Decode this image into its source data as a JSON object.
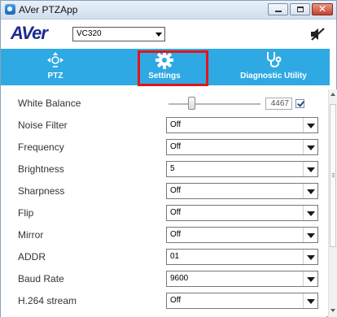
{
  "window": {
    "title": "AVer PTZApp"
  },
  "header": {
    "logo": "AVer",
    "camera_model": "VC320"
  },
  "nav": {
    "items": [
      {
        "label": "PTZ",
        "icon": "ptz-icon"
      },
      {
        "label": "Settings",
        "icon": "gear-icon",
        "selected": true
      },
      {
        "label": "Diagnostic Utility",
        "icon": "stethoscope-icon"
      }
    ]
  },
  "settings": {
    "white_balance": {
      "label": "White Balance",
      "value": "4467",
      "auto_checked": true,
      "slider_fraction": 0.25
    },
    "rows": [
      {
        "label": "Noise Filter",
        "value": "Off"
      },
      {
        "label": "Frequency",
        "value": "Off"
      },
      {
        "label": "Brightness",
        "value": "5"
      },
      {
        "label": "Sharpness",
        "value": "Off"
      },
      {
        "label": "Flip",
        "value": "Off"
      },
      {
        "label": "Mirror",
        "value": "Off"
      },
      {
        "label": "ADDR",
        "value": "01"
      },
      {
        "label": "Baud Rate",
        "value": "9600"
      },
      {
        "label": "H.264 stream",
        "value": "Off"
      }
    ]
  },
  "colors": {
    "accent": "#2fa9e4",
    "highlight": "#e4141b",
    "logo": "#1b2a8f"
  }
}
